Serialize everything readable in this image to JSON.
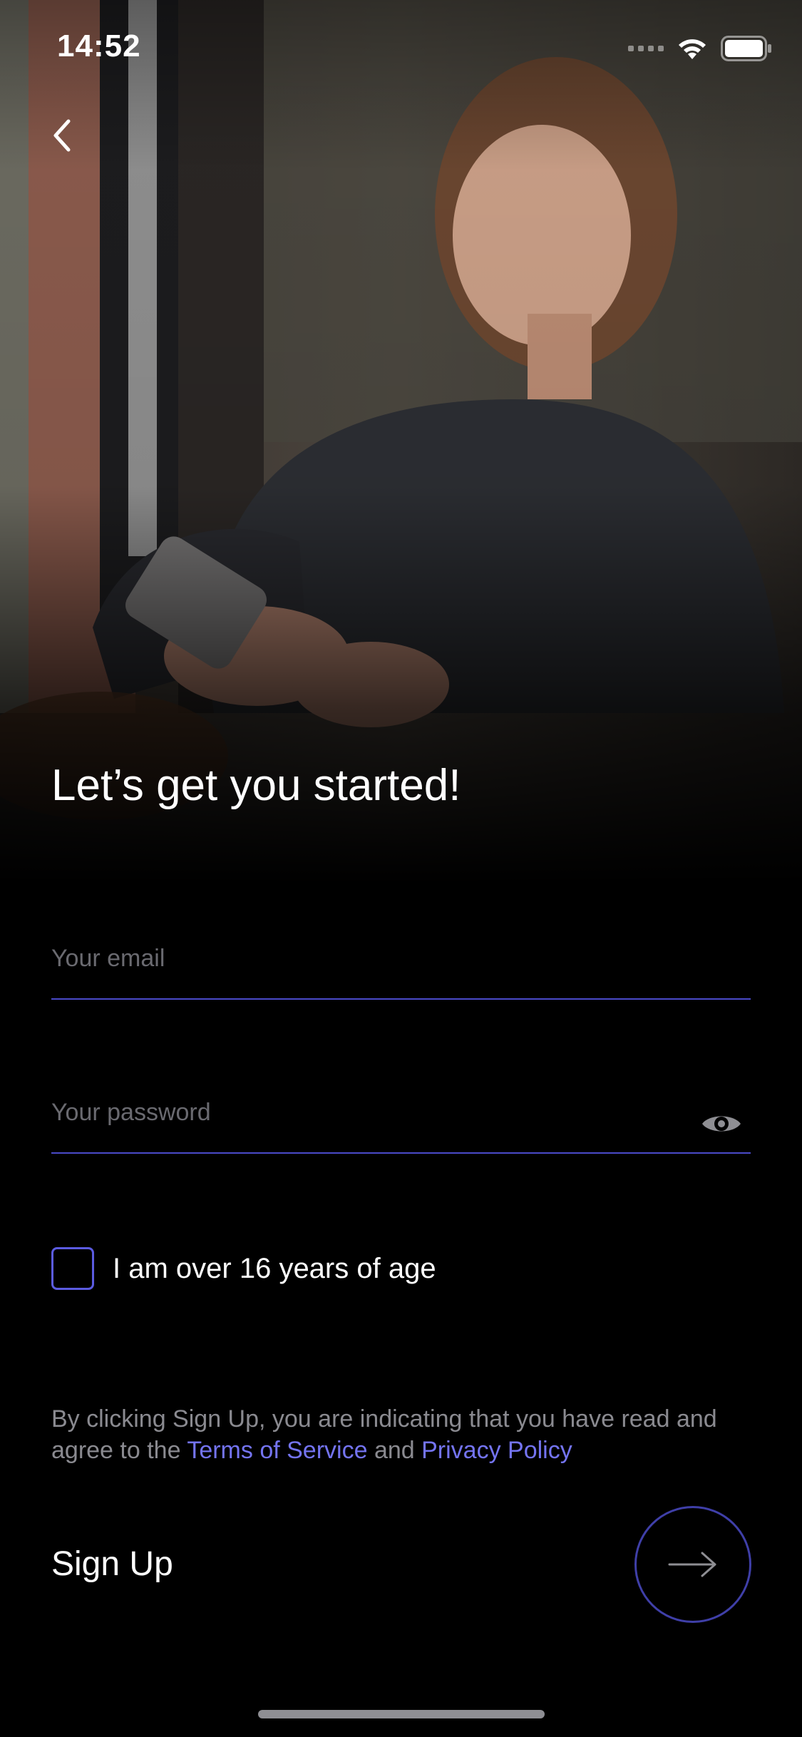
{
  "status_bar": {
    "time": "14:52"
  },
  "colors": {
    "accent": "#5b5be0",
    "link": "#7474f2",
    "background": "#000000"
  },
  "heading": {
    "title": "Let’s get you started!"
  },
  "form": {
    "email_placeholder": "Your email",
    "email_value": "",
    "password_placeholder": "Your password",
    "password_value": "",
    "age_checkbox_checked": false,
    "age_label": "I am over 16 years of age"
  },
  "legal": {
    "prefix": "By clicking Sign Up, you are indicating that you have read and agree to the ",
    "terms_link": "Terms of Service",
    "conjunction": " and ",
    "privacy_link": "Privacy Policy"
  },
  "actions": {
    "signup_label": "Sign Up"
  },
  "icons": {
    "back": "chevron-left-icon",
    "reveal_password": "eye-icon",
    "submit": "arrow-right-icon"
  }
}
